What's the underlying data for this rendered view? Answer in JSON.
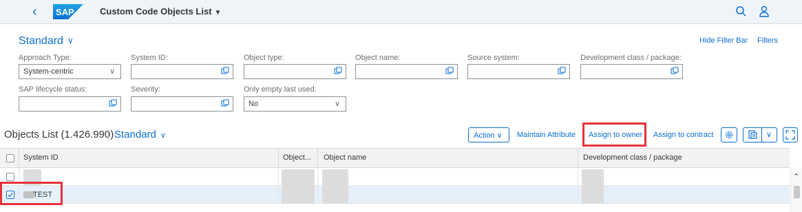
{
  "shell": {
    "app_title": "Custom Code Objects List",
    "logo_text": "SAP",
    "icons": [
      "back-icon",
      "search-icon",
      "user-icon"
    ]
  },
  "filterbar": {
    "variant": "Standard",
    "hide_filter_bar": "Hide Filter Bar",
    "filters": "Filters",
    "fields": {
      "approach_type": {
        "label": "Approach Type:",
        "value": "System-centric"
      },
      "system_id": {
        "label": "System ID:",
        "value": ""
      },
      "object_type": {
        "label": "Object type:",
        "value": ""
      },
      "object_name": {
        "label": "Object name:",
        "value": ""
      },
      "source_system": {
        "label": "Source system:",
        "value": ""
      },
      "dev_class": {
        "label": "Development class / package:",
        "value": ""
      },
      "lifecycle": {
        "label": "SAP lifecycle status:",
        "value": ""
      },
      "severity": {
        "label": "Severity:",
        "value": ""
      },
      "only_empty": {
        "label": "Only empty last used:",
        "value": "No"
      }
    }
  },
  "toolbar": {
    "title": "Objects List (1.426.990)",
    "variant": "Standard",
    "action": "Action",
    "maintain_attribute": "Maintain Attribute",
    "assign_owner": "Assign to owner",
    "assign_contract": "Assign to contract"
  },
  "table": {
    "columns": [
      "System ID",
      "Object...",
      "Object name",
      "Development class / package"
    ],
    "rows": [
      {
        "system_id": "",
        "selected": false
      },
      {
        "system_id": "TEST",
        "selected": true
      }
    ]
  },
  "colors": {
    "accent": "#0a6ed1",
    "highlight": "#e6313a",
    "shell_bg": "#eff4f9"
  }
}
